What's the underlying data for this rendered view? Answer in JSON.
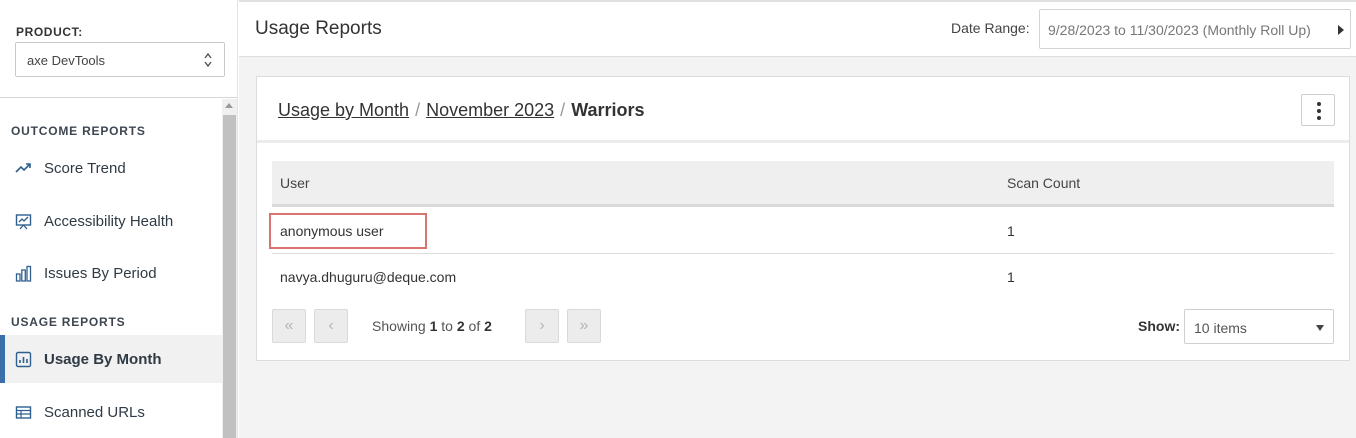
{
  "product": {
    "label": "PRODUCT:",
    "value": "axe DevTools"
  },
  "nav": {
    "outcome_section": "OUTCOME REPORTS",
    "usage_section": "USAGE REPORTS",
    "items": [
      {
        "label": "Score Trend",
        "icon": "trend-icon"
      },
      {
        "label": "Accessibility Health",
        "icon": "presentation-chart-icon"
      },
      {
        "label": "Issues By Period",
        "icon": "bar-chart-icon"
      },
      {
        "label": "Usage By Month",
        "icon": "report-chart-icon",
        "active": true
      },
      {
        "label": "Scanned URLs",
        "icon": "table-icon"
      }
    ]
  },
  "header": {
    "title": "Usage Reports",
    "date_label": "Date Range:",
    "date_value": "9/28/2023 to 11/30/2023 (Monthly Roll Up)"
  },
  "card": {
    "crumbs": [
      "Usage by Month",
      "November 2023",
      "Warriors"
    ],
    "sep": "/"
  },
  "table": {
    "columns": [
      "User",
      "Scan Count"
    ],
    "rows": [
      {
        "user": "anonymous user",
        "count": "1",
        "highlighted": true
      },
      {
        "user": "navya.dhuguru@deque.com",
        "count": "1"
      }
    ]
  },
  "pager": {
    "first": "«",
    "prev": "‹",
    "next": "›",
    "last": "»",
    "showing": "Showing",
    "from": "1",
    "to_word": "to",
    "to": "2",
    "of_word": "of",
    "total": "2",
    "show_label": "Show:",
    "show_value": "10 items"
  },
  "colors": {
    "accent": "#3a6fa8",
    "highlight": "#d9736f"
  }
}
